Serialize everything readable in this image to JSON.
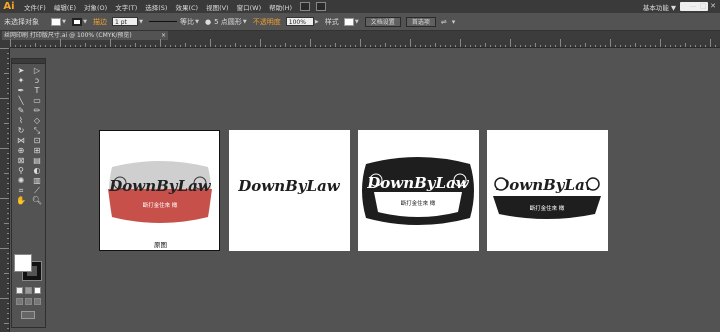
{
  "app": {
    "logo": "Ai"
  },
  "menubar": {
    "items": [
      "文件(F)",
      "编辑(E)",
      "对象(O)",
      "文字(T)",
      "选择(S)",
      "效果(C)",
      "视图(V)",
      "窗口(W)",
      "帮助(H)"
    ],
    "workspace": "基本功能",
    "workspace_arrow": "▼",
    "window_controls": [
      "—",
      "□",
      "✕"
    ]
  },
  "control_bar": {
    "selection": "未选择对象",
    "stroke_label": "描边",
    "stroke_weight": "1 pt",
    "stroke_profile": "等比",
    "brush": "5 点圆形",
    "opacity_label": "不透明度",
    "opacity_value": "100%",
    "style_label": "样式",
    "doc_setup": "文档设置",
    "preferences": "首选项"
  },
  "tab": {
    "title": "丝网印刷 打印版尺寸.ai @ 100% (CMYK/预览)",
    "close": "×"
  },
  "artboards": [
    {
      "label": "原图",
      "logo_text": "DownByLaw",
      "sub_text": "斷打金住來 橄"
    },
    {
      "logo_text": "DownByLaw"
    },
    {
      "logo_text": "DownByLaw",
      "sub_text": "斷打金住來 橄"
    },
    {
      "logo_text": "DownByLaw",
      "sub_text": "斷打金住來 橄"
    }
  ],
  "colors": {
    "menubar": "#3a3a3a",
    "workspace": "#535353",
    "accent_orange": "#f0a030",
    "logo_red": "#c8504a",
    "logo_grey": "#cfcfcf",
    "logo_black": "#1e1e1e"
  }
}
